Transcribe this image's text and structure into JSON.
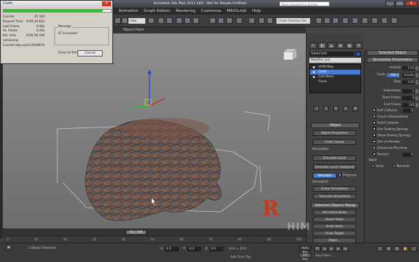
{
  "window": {
    "title": "Autodesk 3ds Max 2012 x64 - Not for Resale    Untitled",
    "search_placeholder": "Type a keyword or phrase",
    "controls": [
      "_",
      "□",
      "X"
    ]
  },
  "menubar": [
    "Animation",
    "Graph Editors",
    "Rendering",
    "Customize",
    "MAXScript",
    "Help"
  ],
  "toolbar": {
    "view_select": "View",
    "selection_set": "Create Selection Set",
    "object_paint": "Object Paint"
  },
  "cloth_dialog": {
    "title": "Cloth",
    "progress": 0.92,
    "stats": [
      {
        "label": "Current",
        "value": "45  100"
      },
      {
        "label": "Elapsed Time",
        "value": "0:00:24.663"
      },
      {
        "label": "Last Frame",
        "value": "0.48s"
      },
      {
        "label": "Av. Frame",
        "value": "0.49s"
      },
      {
        "label": "Est. time remaining",
        "value": "0:00:26.144"
      },
      {
        "label": "Current step size",
        "value": "3.916667e"
      }
    ],
    "message_caption": "Message",
    "message": "dT increased",
    "close_on_finish": "Close on finish",
    "cancel": "Cancel"
  },
  "viewport": {
    "label": "[ + ][ Perspective ][ Smooth + Highlights ]"
  },
  "command_panel": {
    "tabs": [
      "✎",
      "◐",
      "◒",
      "◉",
      "▣",
      "⚒"
    ],
    "object_name": "TableCloth",
    "modifier_list": "Modifier List",
    "stack": [
      {
        "label": "UVW Map",
        "selected": false
      },
      {
        "label": "Cloth",
        "selected": true
      },
      {
        "label": "Edit Mesh",
        "selected": false
      },
      {
        "label": "Plane",
        "selected": false
      }
    ],
    "stack_buttons": [
      "⊣",
      "I",
      "∀",
      "∂",
      "⊞"
    ],
    "object_rollout": "Object",
    "object_properties": "Object Properties",
    "cloth_forces": "Cloth Forces",
    "simulation_label": "Simulation",
    "simulate_local": "Simulate Local",
    "simulate_local_damped": "Simulate Local (damped)",
    "simulate": "Simulate",
    "progress_label": "Progress",
    "simulated_label": "Simulated",
    "erase_simulation": "Erase Simulation",
    "truncate_simulation": "Truncate Simulation",
    "selected_objects_manip": "Selected Objects Manip",
    "set_initial_state": "Set Initial State",
    "reset_state": "Reset State",
    "grab_state": "Grab State",
    "grab_target": "Grab Target",
    "object_rollout2": "Objec..."
  },
  "sim_panel": {
    "selected_object": "Selected Object",
    "simulation_parameters": "Simulation Parameters",
    "rows": [
      {
        "label": "cm/unit",
        "value": "2.54",
        "blue": false
      },
      {
        "label": "Earth",
        "value": "-980.0",
        "blue": true,
        "extra": "Gravity"
      },
      {
        "label": "Step",
        "value": "0.02",
        "blue": false
      },
      {
        "label": "Subsample",
        "value": "1",
        "blue": false
      },
      {
        "label": "Start Frame",
        "value": "0",
        "blue": false
      },
      {
        "label": "End Frame",
        "value": "100",
        "blue": false
      }
    ],
    "checks": [
      "Self Collision",
      "Check Intersections",
      "Solid Collision",
      "Use Sewing Springs",
      "Show Sewing Springs",
      "Sim on Render",
      "Advanced Pinching",
      "Tension"
    ],
    "self_collision_value": "0",
    "tension_value": "0",
    "weld_label": "Weld",
    "verts": "Verts",
    "normals": "Normals"
  },
  "timeline": {
    "slider_label": "45 / 100",
    "ticks": [
      "0",
      "10",
      "20",
      "30",
      "40",
      "50",
      "60",
      "70",
      "80",
      "90",
      "100"
    ]
  },
  "status": {
    "selected": "1 Object Selected",
    "x_label": "X:",
    "x_value": "4.0",
    "y_label": "Y:",
    "y_value": "-0.4",
    "z_label": "Z:",
    "z_value": "0.0",
    "grid": "Grid = 10.0",
    "auto_key": "Auto Key",
    "set_key": "Set Key",
    "key_filters": "Key Filters...",
    "add_time_tag": "Add Time Tag"
  },
  "watermark": {
    "logo_letter": "R",
    "text": "HIM"
  }
}
